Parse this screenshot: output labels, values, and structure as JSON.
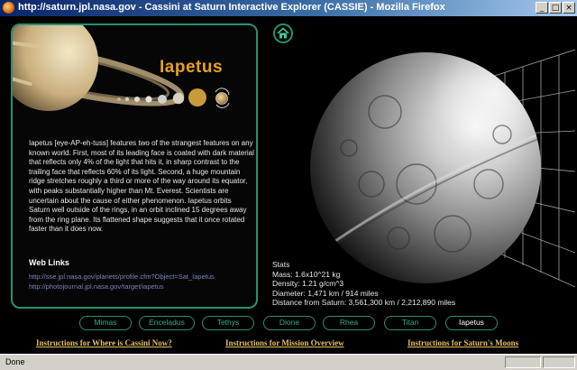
{
  "window": {
    "title": "http://saturn.jpl.nasa.gov - Cassini at Saturn Interactive Explorer (CASSIE) - Mozilla Firefox",
    "minimize": "_",
    "maximize": "□",
    "close": "×"
  },
  "moon": {
    "name": "Iapetus",
    "description": "Iapetus [eye-AP-eh-tuss] features two of the strangest features on any known world. First, most of its leading face is coated with dark material that reflects only 4% of the light that hits it, in sharp contrast to the trailing face that reflects 60% of its light. Second, a huge mountain ridge stretches roughly a third or more of the way around its equator, with peaks substantially higher than Mt. Everest. Scientists are uncertain about the cause of either phenomenon. Iapetus orbits Saturn well outside of the rings, in an orbit inclined 15 degrees away from the ring plane. Its flattened shape suggests that it once rotated faster than it does now."
  },
  "web_links": {
    "heading": "Web Links",
    "links": [
      "http://sse.jpl.nasa.gov/planets/profile.cfm?Object=Sat_Iapetus",
      "http://photojournal.jpl.nasa.gov/target/iapetus"
    ]
  },
  "stats": {
    "heading": "Stats",
    "lines": [
      "Mass: 1.6x10^21 kg",
      "Density: 1.21 g/cm^3",
      "Diameter: 1,471 km / 914 miles",
      "Distance from Saturn: 3,561,300 km / 2,212,890 miles"
    ]
  },
  "nav": {
    "moons": [
      "Mimas",
      "Enceladus",
      "Tethys",
      "Dione",
      "Rhea",
      "Titan",
      "Iapetus"
    ],
    "active": "Iapetus"
  },
  "instructions": [
    "Instructions for Where is Cassini Now?",
    "Instructions for Mission Overview",
    "Instructions for Saturn's Moons"
  ],
  "status": {
    "text": "Done"
  },
  "icons": {
    "home": "home-icon",
    "browser": "firefox-icon"
  },
  "colors": {
    "accent": "#2a8f74",
    "title_orange": "#e8a020",
    "link_gold": "#e8c060",
    "nav_text": "#3aa98a"
  }
}
